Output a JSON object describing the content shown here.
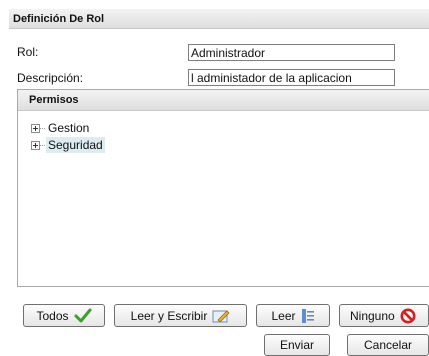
{
  "panel": {
    "title": "Definición De Rol"
  },
  "form": {
    "rol_label": "Rol:",
    "rol_value": "Administrador",
    "descripcion_label": "Descripción:",
    "descripcion_value": "l administador de la aplicacion"
  },
  "permisos": {
    "title": "Permisos",
    "nodes": [
      {
        "label": "Gestion",
        "icon": "plus-expander-icon",
        "selected": false
      },
      {
        "label": "Seguridad",
        "icon": "plus-expander-icon",
        "selected": true
      }
    ]
  },
  "buttons": {
    "todos": {
      "label": "Todos",
      "icon": "green-checkmark-icon"
    },
    "leer_escribir": {
      "label": "Leer y Escribir",
      "icon": "edit-pencil-icon"
    },
    "leer": {
      "label": "Leer",
      "icon": "read-document-icon"
    },
    "ninguno": {
      "label": "Ninguno",
      "icon": "no-entry-icon"
    },
    "enviar": {
      "label": "Enviar"
    },
    "cancelar": {
      "label": "Cancelar"
    }
  },
  "colors": {
    "selected_node_bg": "#dcecf0",
    "check_green": "#3aa12a",
    "no_entry_red": "#d42020"
  }
}
